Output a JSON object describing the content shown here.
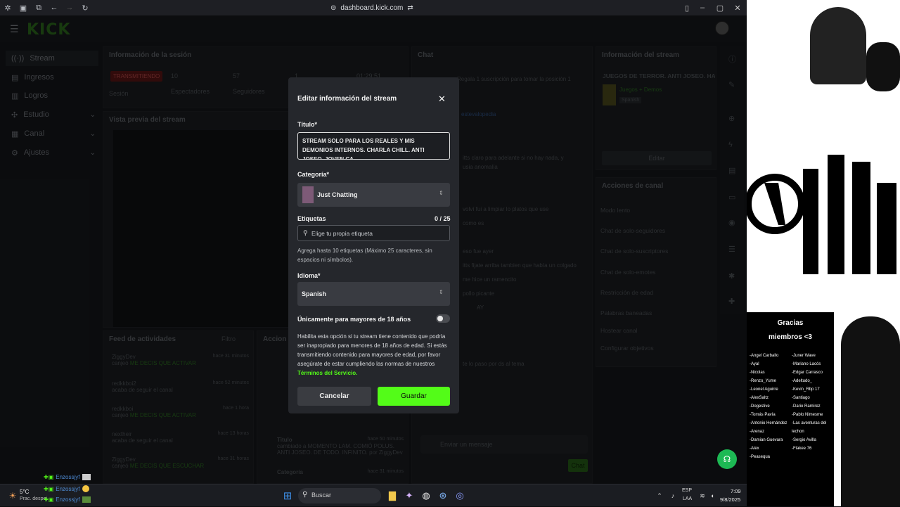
{
  "browser": {
    "url": "dashboard.kick.com"
  },
  "app": {
    "logo": "KICK"
  },
  "sidebar": {
    "items": [
      {
        "label": "Stream",
        "icon": "stream-icon"
      },
      {
        "label": "Ingresos",
        "icon": "income-icon"
      },
      {
        "label": "Logros",
        "icon": "trophy-icon"
      },
      {
        "label": "Estudio",
        "icon": "studio-icon"
      },
      {
        "label": "Canal",
        "icon": "channel-icon"
      },
      {
        "label": "Ajustes",
        "icon": "settings-icon"
      }
    ]
  },
  "session": {
    "title": "Información de la sesión",
    "status": "TRANSMITIENDO",
    "status_label": "Sesión",
    "viewers": "10",
    "viewers_label": "Espectadores",
    "followers": "57",
    "followers_label": "Seguidores",
    "third": "1",
    "time": "01:29:51"
  },
  "preview": {
    "title": "Vista previa del stream"
  },
  "feed": {
    "title": "Feed de actividades",
    "filter": "Filtro",
    "items": [
      {
        "user": "ZiggyDev",
        "time": "hace 31 minutos",
        "text": "canjeó",
        "reward": "ME DECIS QUE ACTIVAR"
      },
      {
        "user": "redkkboi2",
        "time": "hace 52 minutos",
        "text": "acaba de seguir el canal",
        "reward": ""
      },
      {
        "user": "redkkboi",
        "time": "hace 1 hora",
        "text": "canjeó",
        "reward": "ME DECIS QUE ACTIVAR"
      },
      {
        "user": "nextheir",
        "time": "hace 13 horas",
        "text": "acaba de seguir el canal",
        "reward": ""
      },
      {
        "user": "ZiggyDev",
        "time": "hace 31 horas",
        "text": "canjeó",
        "reward": "ME DECIS QUE ESCUCHAR"
      }
    ]
  },
  "actions_panel": {
    "title": "Accion",
    "rows": [
      {
        "label": "Titulo",
        "time": "hace 50 minutos",
        "text": "cambiado a MOMENTO LAM. COMIÓ POLUS. ANTI JOSEO. DE TODO. INFINITO. por ZiggyDev"
      },
      {
        "label": "Categoría",
        "time": "hace 31 minutos",
        "text": ""
      }
    ]
  },
  "chat": {
    "title": "Chat",
    "gift": "Regala 1 suscripción para tomar la posición 1",
    "pinned_user": "estevalopedia",
    "placeholder": "Enviar un mensaje",
    "send": "Chat",
    "messages": [
      "itts claro para adelante si no hay nada, y",
      "usia anomalía",
      "volví fui a limpiar lo platos que use",
      "como es",
      "eso fue ayer",
      "itts fijate arriba tambien que había un colgado",
      "me hice un ramencito",
      "pollo picante",
      "AY",
      "te lo paso por ds al tema"
    ]
  },
  "stream_info": {
    "title": "Información del stream",
    "stream_title": "JUEGOS DE TERROR. ANTI JOSEO. HAHA",
    "category": "Juegos + Demos",
    "language": "Spanish",
    "edit": "Editar"
  },
  "channel_actions": {
    "title": "Acciones de canal",
    "items": [
      "Modo lento",
      "Chat de solo-seguidores",
      "Chat de solo-suscriptores",
      "Chat de solo-emotes",
      "Restricción de edad",
      "Palabras baneadas",
      "Hostear canal",
      "Configurar objetivos"
    ]
  },
  "modal": {
    "title": "Editar información del stream",
    "title_label": "Título*",
    "title_value": "STREAM SOLO PARA LOS REALES Y MIS DEMONIOS INTERNOS. CHARLA CHILL. ANTI JOSEO. JOVEN CA",
    "category_label": "Categoría*",
    "category_value": "Just Chatting",
    "tags_label": "Etiquetas",
    "tags_count": "0 / 25",
    "tags_placeholder": "Elige tu propia etiqueta",
    "tags_help": "Agrega hasta 10 etiquetas (Máximo 25 caracteres, sin espacios ni símbolos).",
    "language_label": "Idioma*",
    "language_value": "Spanish",
    "adult_label": "Únicamente para mayores de 18 años",
    "adult_help": "Habilita esta opción si tu stream tiene contenido que podría ser inapropiado para menores de 18 años de edad. Si estás transmitiendo contenido para mayores de edad, por favor asegúrate de estar cumpliendo las normas de nuestros",
    "terms_link": "Términos del Servicio.",
    "cancel": "Cancelar",
    "save": "Guardar"
  },
  "overlay_chat": [
    {
      "user": "Enzossjyf"
    },
    {
      "user": "Enzossjyf"
    },
    {
      "user": "Enzossjyf"
    }
  ],
  "weather": {
    "temp": "5°C",
    "desc": "Prac. despej"
  },
  "taskbar": {
    "search": "Buscar",
    "lang": "ESP",
    "lang2": "LAA",
    "time": "7:09",
    "date": "9/8/2025"
  },
  "webcam": {
    "thanks_title": "Gracias",
    "thanks_sub": "miembros <3",
    "members_left": [
      "-Angel Carballo",
      "-Ayal",
      "-Nicolas",
      "-Renzo_Yume",
      "-Leonel Aguirre",
      "-AlexSaltz",
      "-Dogestive",
      "-Tomás Pavía",
      "-Antonio Hernández",
      "-Arenaz",
      "-Damian Guevara",
      "-Alex",
      "-Peasequa"
    ],
    "members_right": [
      "-Juner Wave",
      "-Mariano Lacós",
      "-Edgar Carrasco",
      "-Adeltudo_",
      "-Kevin_Rbp 17",
      "-Santiago",
      "-Dario Ramírez",
      "-Pablo Nimesme",
      "-Las aventuras del",
      "  lechon",
      "-Sergio Avilla",
      "-Flakee 76",
      ""
    ]
  },
  "colors": {
    "accent": "#53fc18",
    "modal_bg": "#25272c",
    "page_bg": "#15171b"
  }
}
